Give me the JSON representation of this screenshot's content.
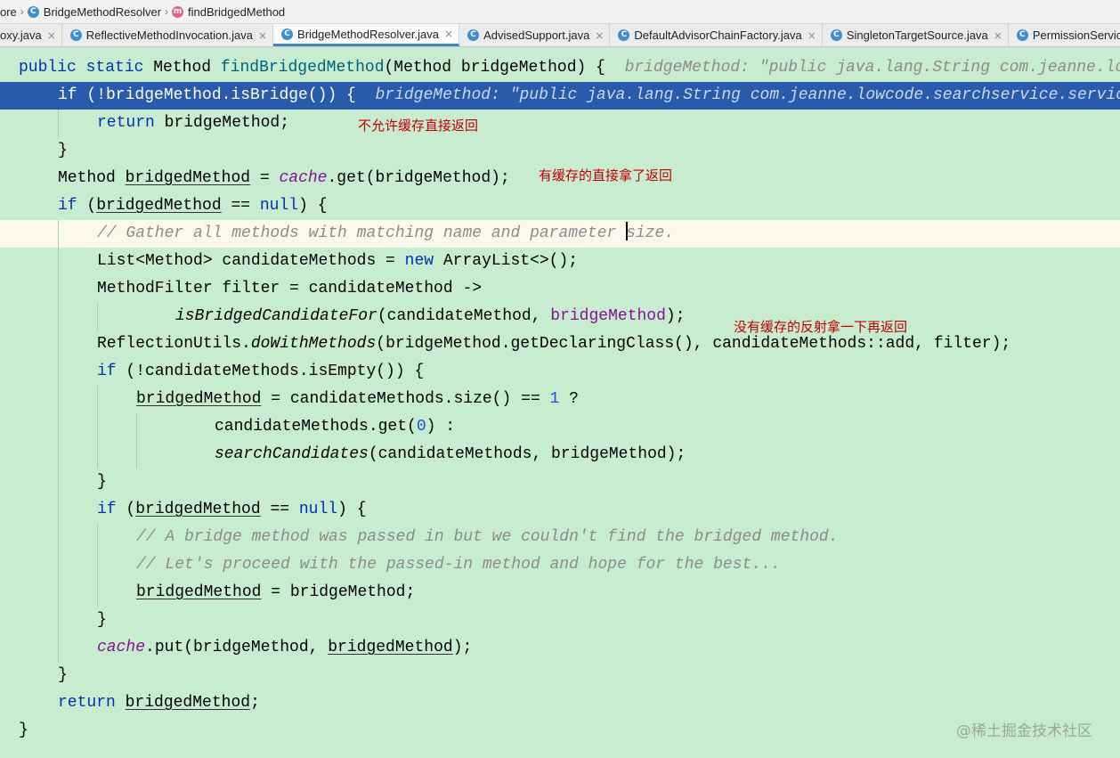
{
  "breadcrumb": [
    {
      "label": "ore",
      "icon": ""
    },
    {
      "label": "BridgeMethodResolver",
      "icon": "class-icon"
    },
    {
      "label": "findBridgedMethod",
      "icon": "method-icon"
    }
  ],
  "tabs": [
    {
      "label": "oxy.java",
      "active": false
    },
    {
      "label": "ReflectiveMethodInvocation.java",
      "active": false
    },
    {
      "label": "BridgeMethodResolver.java",
      "active": true
    },
    {
      "label": "AdvisedSupport.java",
      "active": false
    },
    {
      "label": "DefaultAdvisorChainFactory.java",
      "active": false
    },
    {
      "label": "SingletonTargetSource.java",
      "active": false
    },
    {
      "label": "PermissionService",
      "active": false
    }
  ],
  "icons": {
    "class": "C",
    "method": "m",
    "close": "×"
  },
  "code": {
    "l1": {
      "t1": "public",
      "t2": " ",
      "t3": "static",
      "t4": " Method ",
      "t5": "findBridgedMethod",
      "t6": "(Method bridgeMethod) {",
      "hint": "bridgeMethod: \"public java.lang.String com.jeanne.lowcode.searchservice"
    },
    "l2": {
      "t1": "if (!bridgeMethod.isBridge()) {",
      "hint": "bridgeMethod: \"public java.lang.String com.jeanne.lowcode.searchservice.service"
    },
    "l3": {
      "t1": "return",
      "t2": " bridgeMethod;"
    },
    "l4": {
      "t1": "}"
    },
    "l5": {
      "t1": "Method ",
      "t2": "bridgedMethod",
      "t3": " = ",
      "t4": "cache",
      "t5": ".get(bridgeMethod);"
    },
    "l6": {
      "t1": "if",
      "t2": " (",
      "t3": "bridgedMethod",
      "t4": " == ",
      "t5": "null",
      "t6": ") {"
    },
    "l7": {
      "t1": "// Gather all methods with matching name and parameter ",
      "t2": "size."
    },
    "l8": {
      "t1": "List<Method> candidateMethods = ",
      "t2": "new",
      "t3": " ArrayList<>();"
    },
    "l9": {
      "t1": "MethodFilter filter = candidateMethod ->"
    },
    "l10": {
      "t1": "isBridgedCandidateFor",
      "t2": "(candidateMethod, ",
      "t3": "bridgeMethod",
      "t4": ");"
    },
    "l11": {
      "t1": "ReflectionUtils.",
      "t2": "doWithMethods",
      "t3": "(bridgeMethod.getDeclaringClass(), candidateMethods::add, filter);"
    },
    "l12": {
      "t1": "if",
      "t2": " (!candidateMethods.isEmpty()) {"
    },
    "l13": {
      "t1": "bridgedMethod",
      "t2": " = candidateMethods.size() == ",
      "t3": "1",
      "t4": " ?"
    },
    "l14": {
      "t1": "candidateMethods.get(",
      "t2": "0",
      "t3": ") :"
    },
    "l15": {
      "t1": "searchCandidates",
      "t2": "(candidateMethods, bridgeMethod);"
    },
    "l16": {
      "t1": "}"
    },
    "l17": {
      "t1": "if",
      "t2": " (",
      "t3": "bridgedMethod",
      "t4": " == ",
      "t5": "null",
      "t6": ") {"
    },
    "l18": {
      "t1": "// A bridge method was passed in but we couldn't find the bridged method."
    },
    "l19": {
      "t1": "// Let's proceed with the passed-in method and hope for the best..."
    },
    "l20": {
      "t1": "bridgedMethod",
      "t2": " = bridgeMethod;"
    },
    "l21": {
      "t1": "}"
    },
    "l22": {
      "t1": "cache",
      "t2": ".put(bridgeMethod, ",
      "t3": "bridgedMethod",
      "t4": ");"
    },
    "l23": {
      "t1": "}"
    },
    "l24": {
      "t1": "return",
      "t2": " ",
      "t3": "bridgedMethod",
      "t4": ";"
    },
    "l25": {
      "t1": "}"
    }
  },
  "annotations": {
    "no_cache": "不允许缓存直接返回",
    "cached": "有缓存的直接拿了返回",
    "reflect": "没有缓存的反射拿一下再返回"
  },
  "watermark": "@稀土掘金技术社区"
}
